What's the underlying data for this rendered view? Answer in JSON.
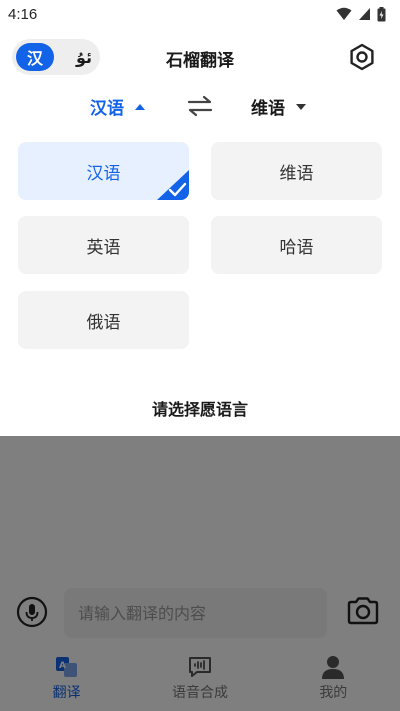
{
  "status_bar": {
    "time": "4:16"
  },
  "header": {
    "title": "石榴翻译",
    "lang_switch": {
      "active": "汉",
      "inactive": "ئۇ"
    }
  },
  "language_selector": {
    "source": "汉语",
    "target": "维语"
  },
  "language_panel": {
    "options": [
      "汉语",
      "维语",
      "英语",
      "哈语",
      "俄语"
    ],
    "selected": "汉语",
    "footer_title": "请选择愿语言"
  },
  "input": {
    "placeholder": "请输入翻译的内容"
  },
  "bottom_nav": {
    "items": [
      {
        "label": "翻译",
        "icon": "translate-icon"
      },
      {
        "label": "语音合成",
        "icon": "voice-synthesis-icon"
      },
      {
        "label": "我的",
        "icon": "profile-icon"
      }
    ],
    "active": "翻译"
  },
  "colors": {
    "accent": "#1363e8",
    "card": "#f3f3f4",
    "selected_card": "#e6f0fe"
  }
}
